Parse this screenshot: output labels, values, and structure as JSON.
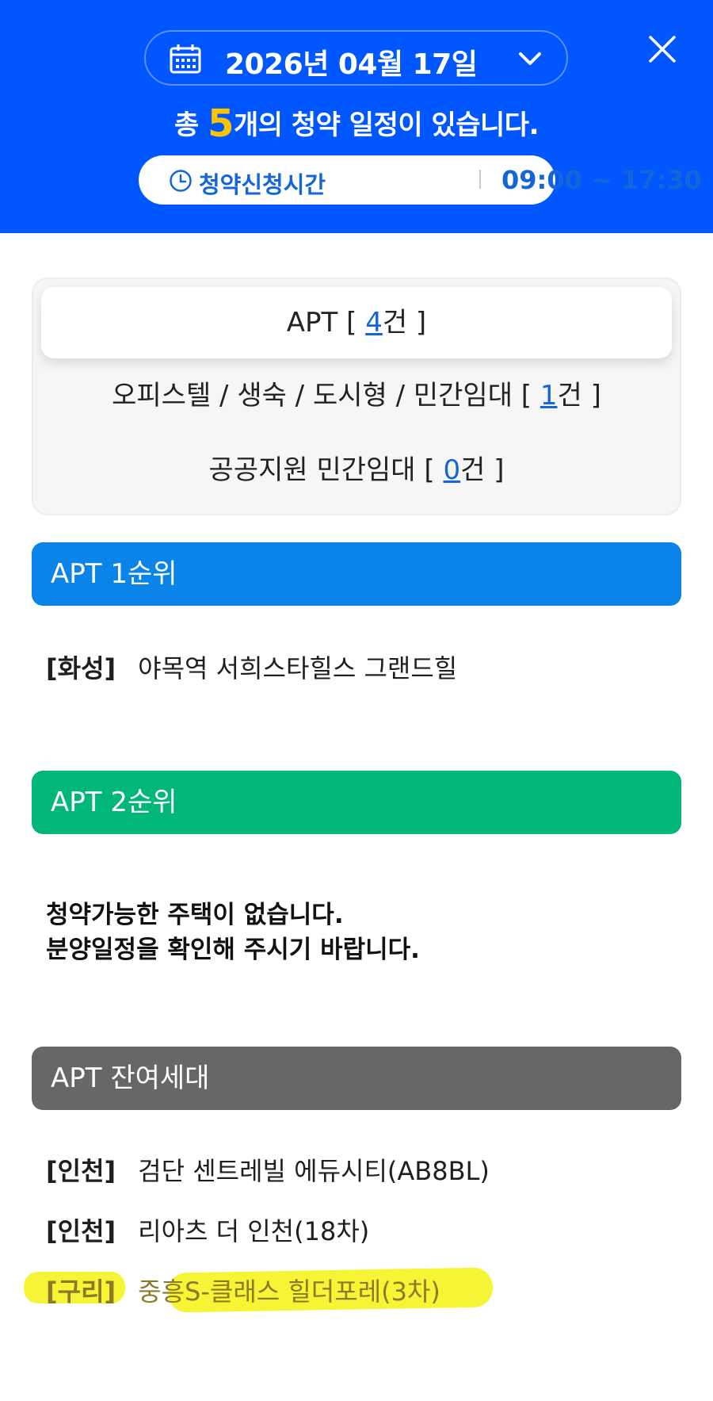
{
  "header": {
    "date": "2026년 04월 17일",
    "summary_prefix": "총 ",
    "summary_count": "5",
    "summary_suffix": "개의 청약 일정이 있습니다.",
    "time_label": "청약신청시간",
    "time_value": "09:00 ~ 17:30"
  },
  "tabs": [
    {
      "label": "APT [ ",
      "count": "4",
      "suffix": "건 ]"
    },
    {
      "label": "오피스텔 / 생숙 / 도시형 / 민간임대 [ ",
      "count": "1",
      "suffix": "건 ]"
    },
    {
      "label": "공공지원 민간임대 [ ",
      "count": "0",
      "suffix": "건 ]"
    }
  ],
  "sections": {
    "rank1": {
      "title": "APT 1순위",
      "items": [
        {
          "region": "[화성]",
          "name": "야목역 서희스타힐스 그랜드힐"
        }
      ]
    },
    "rank2": {
      "title": "APT 2순위",
      "notice_line1": "청약가능한 주택이 없습니다.",
      "notice_line2": "분양일정을 확인해 주시기 바랍니다."
    },
    "remaining": {
      "title": "APT 잔여세대",
      "items": [
        {
          "region": "[인천]",
          "name": "검단 센트레빌 에듀시티(AB8BL)"
        },
        {
          "region": "[인천]",
          "name": "리아츠 더 인천(18차)"
        },
        {
          "region": "[구리]",
          "name": "중흥S-클래스 힐더포레(3차)"
        }
      ]
    }
  },
  "colors": {
    "header_bg": "#0057ff",
    "count_accent": "#ffc400",
    "rank1_bg": "#0a84e8",
    "rank2_bg": "#00b67a",
    "remaining_bg": "#676767",
    "highlight": "#f5f535"
  },
  "icons": {
    "calendar": "calendar-icon",
    "chevron": "chevron-down-icon",
    "close": "close-icon",
    "clock": "clock-icon"
  }
}
